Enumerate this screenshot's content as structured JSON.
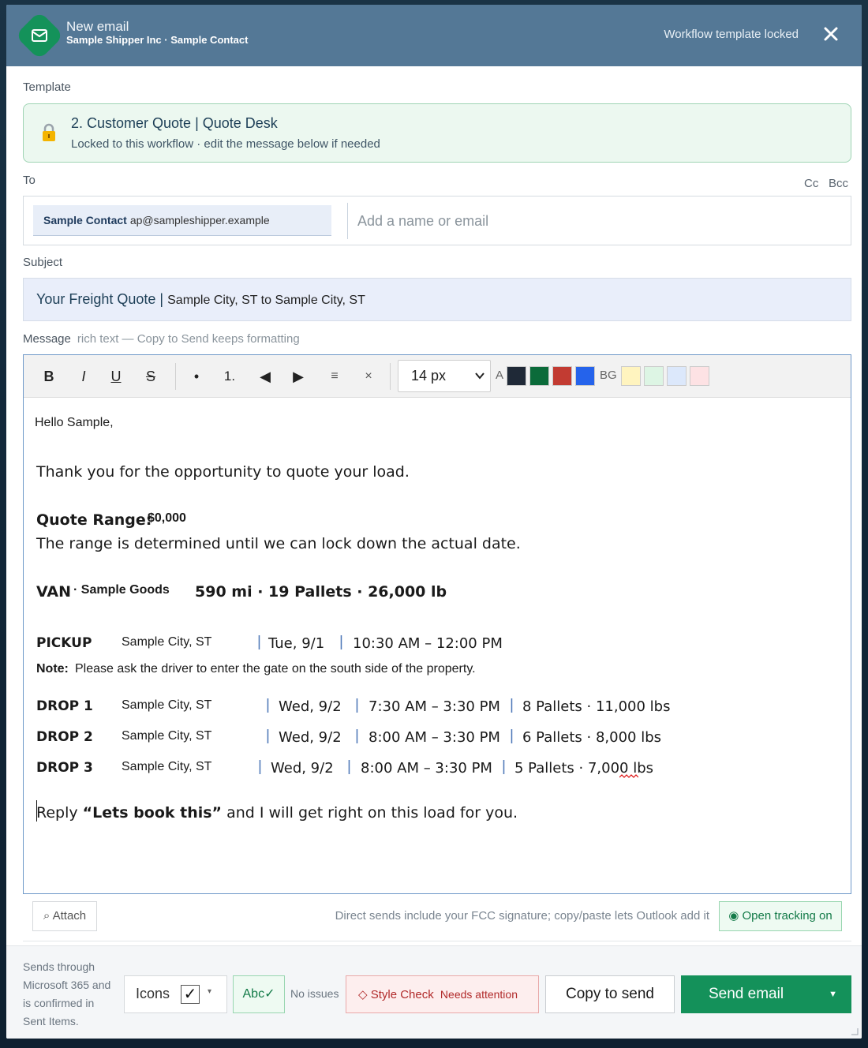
{
  "header": {
    "title": "New email",
    "subtitle": "Sample Shipper Inc · Sample Contact",
    "status": "Workflow template locked"
  },
  "template": {
    "label": "Template",
    "name": "2. Customer Quote | Quote Desk",
    "note": "Locked to this workflow · edit the message below if needed"
  },
  "to": {
    "label": "To",
    "cc": "Cc",
    "bcc": "Bcc",
    "recipient_name": "Sample Contact",
    "recipient_email": "ap@sampleshipper.example",
    "placeholder": "Add a name or email"
  },
  "subject": {
    "label": "Subject",
    "prefix": "Your Freight Quote |",
    "rest": "Sample City, ST to Sample City, ST"
  },
  "message": {
    "label": "Message",
    "hint": "rich text — Copy to Send keeps formatting"
  },
  "toolbar": {
    "bold": "B",
    "italic": "I",
    "underline": "U",
    "strike": "S",
    "bullet": "•",
    "numbered": "1.",
    "outdent": "◀",
    "indent": "▶",
    "align": "≡",
    "clear": "×",
    "font_size": "14 px",
    "text_color_label": "A",
    "bg_label": "BG",
    "text_colors": [
      "#1f2937",
      "#0b6b3a",
      "#c23b32",
      "#2563eb"
    ],
    "bg_colors": [
      "#fff4bf",
      "#ddf5e4",
      "#dce8fb",
      "#fde2e4"
    ]
  },
  "body": {
    "greeting": "Hello Sample,",
    "intro": "Thank you for the opportunity to quote your load.",
    "quote_label": "Quote Range:",
    "quote_value": "$0,000",
    "range_note": "The range is determined until we can lock down the actual date.",
    "equipment": "VAN",
    "commodity": "· Sample Goods",
    "load_summary": "590 mi · 19 Pallets · 26,000 lb",
    "pickup": {
      "label": "PICKUP",
      "city": "Sample City, ST",
      "date": "Tue, 9/1",
      "window": "10:30 AM – 12:00 PM"
    },
    "note_label": "Note:",
    "note_text": "Please ask the driver to enter the gate on the south side of the property.",
    "drops": [
      {
        "label": "DROP 1",
        "city": "Sample City, ST",
        "date": "Wed, 9/2",
        "window": "7:30 AM – 3:30 PM",
        "pallets": "8 Pallets",
        "weight": "11,000 lbs"
      },
      {
        "label": "DROP 2",
        "city": "Sample City, ST",
        "date": "Wed, 9/2",
        "window": "8:00 AM – 3:30 PM",
        "pallets": "6 Pallets",
        "weight": "8,000 lbs"
      },
      {
        "label": "DROP 3",
        "city": "Sample City, ST",
        "date": "Wed, 9/2",
        "window": "8:00 AM – 3:30 PM",
        "pallets": "5 Pallets",
        "weight": "7,000 lbs"
      }
    ],
    "cta_pre": "Reply",
    "cta_bold": "“Lets book this”",
    "cta_post": "and I will get right on this load for you."
  },
  "attach": {
    "button": "⌕ Attach",
    "signature_note": "Direct sends include your FCC signature; copy/paste lets Outlook add it",
    "tracking": "◉ Open tracking on"
  },
  "footer": {
    "sends_note": "Sends through Microsoft 365 and is confirmed in Sent Items.",
    "icons_label": "Icons",
    "icons_check": "✓",
    "spell_button": "Abc✓",
    "no_issues": "No issues",
    "style_check_label": "◇ Style Check",
    "style_check_status": "Needs attention",
    "copy_button": "Copy to send",
    "send_button": "Send email",
    "send_caret": "▼"
  }
}
